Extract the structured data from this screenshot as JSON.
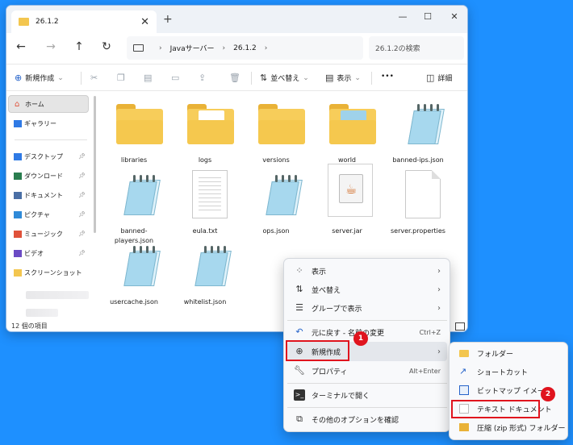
{
  "window": {
    "tab_title": "26.1.2",
    "close_tab": "✕",
    "new_tab": "+",
    "minimize": "—",
    "maximize": "☐",
    "close": "✕"
  },
  "address": {
    "back": "←",
    "forward": "→",
    "up": "↑",
    "refresh": "↻",
    "crumbs": [
      "Javaサーバー",
      "26.1.2"
    ],
    "search_placeholder": "26.1.2の検索"
  },
  "command_bar": {
    "new_label": "新規作成",
    "sort_label": "並べ替え",
    "view_label": "表示",
    "more_label": "•••",
    "details_label": "詳細"
  },
  "sidebar": {
    "home": "ホーム",
    "gallery": "ギャラリー",
    "items": [
      {
        "label": "デスクトップ",
        "icon": "desktop-icon",
        "color": "#2f7ae5"
      },
      {
        "label": "ダウンロード",
        "icon": "download-icon",
        "color": "#2a7d4f"
      },
      {
        "label": "ドキュメント",
        "icon": "document-icon",
        "color": "#4a6fa5"
      },
      {
        "label": "ピクチャ",
        "icon": "pictures-icon",
        "color": "#2f8ad8"
      },
      {
        "label": "ミュージック",
        "icon": "music-icon",
        "color": "#e0523a"
      },
      {
        "label": "ビデオ",
        "icon": "video-icon",
        "color": "#6b4bc4"
      },
      {
        "label": "スクリーンショット",
        "icon": "folder-icon",
        "color": "#f3c64f"
      }
    ]
  },
  "files": [
    {
      "name": "libraries",
      "type": "folder"
    },
    {
      "name": "logs",
      "type": "folder-paper"
    },
    {
      "name": "versions",
      "type": "folder"
    },
    {
      "name": "world",
      "type": "folder-img"
    },
    {
      "name": "banned-ips.json",
      "type": "notepad"
    },
    {
      "name": "banned-players.json",
      "type": "notepad"
    },
    {
      "name": "eula.txt",
      "type": "text"
    },
    {
      "name": "ops.json",
      "type": "notepad"
    },
    {
      "name": "server.jar",
      "type": "jar"
    },
    {
      "name": "server.properties",
      "type": "blank"
    },
    {
      "name": "usercache.json",
      "type": "notepad"
    },
    {
      "name": "whitelist.json",
      "type": "notepad"
    }
  ],
  "status": "12 個の項目",
  "context_menu": {
    "view": "表示",
    "sort": "並べ替え",
    "group": "グループで表示",
    "undo": "元に戻す - 名前の変更",
    "undo_shortcut": "Ctrl+Z",
    "new": "新規作成",
    "properties": "プロパティ",
    "properties_shortcut": "Alt+Enter",
    "terminal": "ターミナルで開く",
    "more_options": "その他のオプションを確認"
  },
  "submenu": {
    "folder": "フォルダー",
    "shortcut": "ショートカット",
    "bitmap": "ビットマップ イメージ",
    "text_document": "テキスト ドキュメント",
    "zip": "圧縮 (zip 形式) フォルダー"
  },
  "badges": {
    "step1": "1",
    "step2": "2"
  },
  "colors": {
    "desktop": "#1e90ff",
    "highlight": "#e0141e",
    "folder": "#f7cd5a"
  }
}
